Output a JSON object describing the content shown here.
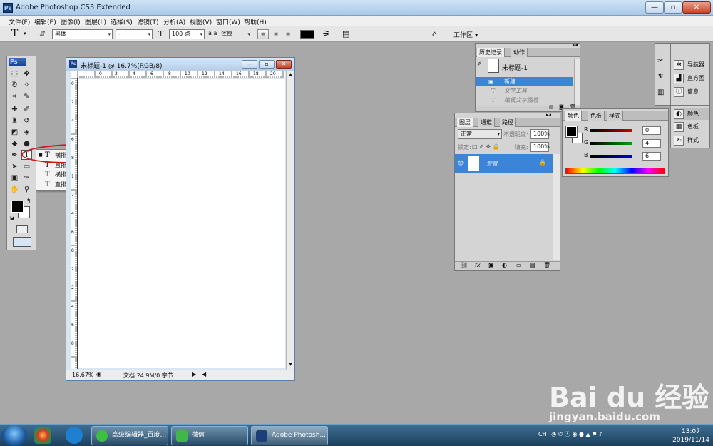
{
  "window": {
    "title": "Adobe Photoshop CS3 Extended",
    "app_icon": "Ps",
    "minimize": "—",
    "maximize": "▫",
    "close": "✕"
  },
  "menu": [
    "文件(F)",
    "编辑(E)",
    "图像(I)",
    "图层(L)",
    "选择(S)",
    "滤镜(T)",
    "分析(A)",
    "视图(V)",
    "窗口(W)",
    "帮助(H)"
  ],
  "options_bar": {
    "font_family": "黑体",
    "font_style": "-",
    "font_size": "100 点",
    "antialias": "浑厚",
    "workspace": "工作区 ▾",
    "aa_icon": "a a"
  },
  "toolbox": {
    "ps_label": "Ps"
  },
  "type_flyout": {
    "items": [
      {
        "icon": "T",
        "label": "横排文字工具",
        "shortcut": "T"
      },
      {
        "icon": "T",
        "label": "直排文字工具",
        "shortcut": "T"
      },
      {
        "icon": "T",
        "label": "横排文字蒙版工具",
        "shortcut": "T"
      },
      {
        "icon": "T",
        "label": "直排文字蒙版工具",
        "shortcut": "T"
      }
    ]
  },
  "document": {
    "title": "未标题-1 @ 16.7%(RGB/8)",
    "zoom": "16.67%",
    "doc_info": "文档:24.9M/0 字节",
    "h_ruler": [
      "0",
      "2",
      "4",
      "6",
      "8",
      "10",
      "12",
      "14",
      "16",
      "18",
      "20"
    ],
    "v_ruler": [
      "0",
      "2",
      "4",
      "6",
      "8",
      "1",
      "2",
      "4",
      "6",
      "8",
      "2",
      "2",
      "4",
      "6",
      "8"
    ]
  },
  "history_panel": {
    "tabs": [
      "历史记录",
      "动作"
    ],
    "snapshot": "未标题-1",
    "items": [
      "新建",
      "文字工具",
      "编辑文字图层"
    ]
  },
  "layers_panel": {
    "tabs": [
      "图层",
      "通道",
      "路径"
    ],
    "blend_mode": "正常",
    "opacity_label": "不透明度:",
    "opacity": "100%",
    "lock_label": "锁定:",
    "fill_label": "填充:",
    "fill": "100%",
    "layer_name": "背景"
  },
  "color_panel": {
    "tabs": [
      "颜色",
      "色板",
      "样式"
    ],
    "channels": [
      {
        "label": "R",
        "value": "0",
        "color": "#cc0000"
      },
      {
        "label": "G",
        "value": "4",
        "color": "#00a000"
      },
      {
        "label": "B",
        "value": "6",
        "color": "#0000cc"
      }
    ]
  },
  "dock": {
    "top": [
      "导航器",
      "直方图",
      "信息"
    ],
    "bottom": [
      "颜色",
      "色板",
      "样式"
    ]
  },
  "taskbar": {
    "buttons": [
      "高级编辑器_百度...",
      "微信",
      "Adobe Photosh..."
    ],
    "time": "13:07",
    "date": "2019/11/14",
    "lang": "CH"
  },
  "watermark": {
    "brand": "Bai du 经验",
    "url": "jingyan.baidu.com"
  }
}
